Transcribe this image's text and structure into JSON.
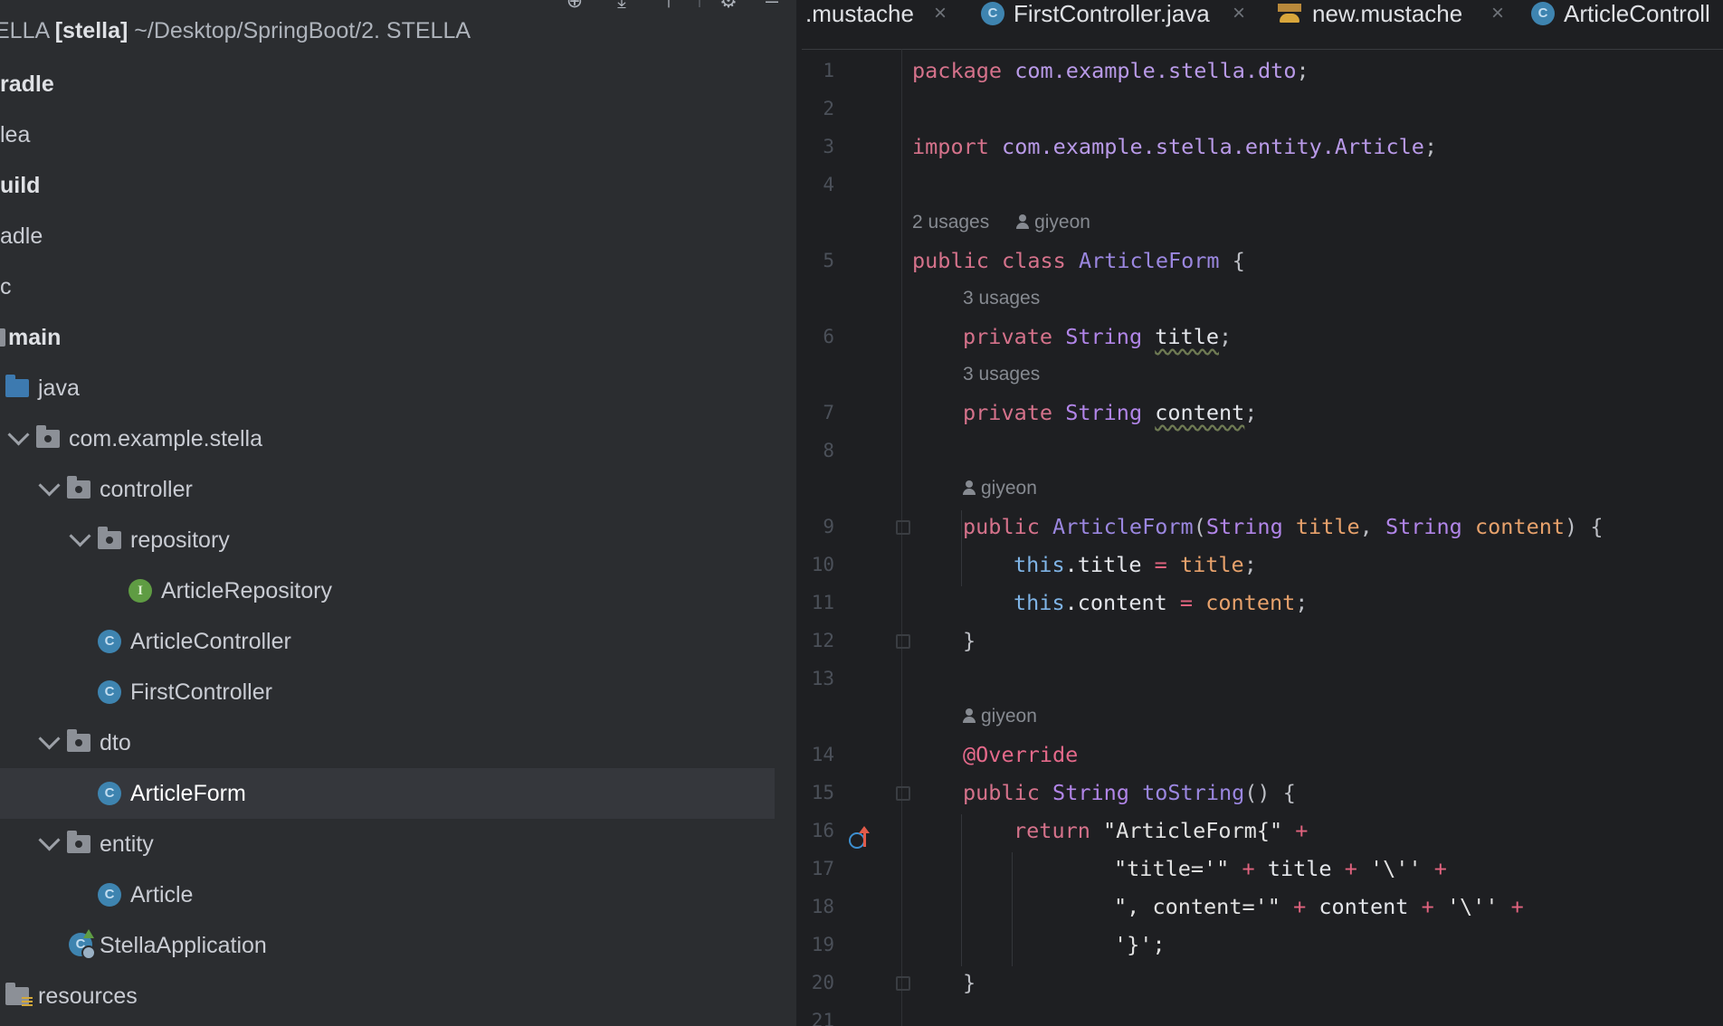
{
  "project": {
    "root_name": "ELLA",
    "root_bold": "[stella]",
    "root_path": "~/Desktop/SpringBoot/2. STELLA",
    "tree": [
      {
        "label": "radle",
        "bold": true
      },
      {
        "label": "lea"
      },
      {
        "label": "uild",
        "bold": true
      },
      {
        "label": "adle"
      },
      {
        "label": "c"
      },
      {
        "label": "main",
        "bold": true
      },
      {
        "label": "java"
      },
      {
        "label": "com.example.stella"
      },
      {
        "label": "controller"
      },
      {
        "label": "repository"
      },
      {
        "label": "ArticleRepository"
      },
      {
        "label": "ArticleController"
      },
      {
        "label": "FirstController"
      },
      {
        "label": "dto"
      },
      {
        "label": "ArticleForm"
      },
      {
        "label": "entity"
      },
      {
        "label": "Article"
      },
      {
        "label": "StellaApplication"
      },
      {
        "label": "resources"
      }
    ],
    "icons": {
      "class_letter": "C",
      "interface_letter": "I"
    }
  },
  "tabs": [
    {
      "label": ".mustache",
      "icon": "none"
    },
    {
      "label": "FirstController.java",
      "icon": "class-icon"
    },
    {
      "label": "new.mustache",
      "icon": "mustache-icon"
    },
    {
      "label": "ArticleControll",
      "icon": "class-icon"
    }
  ],
  "editor": {
    "line_numbers": [
      "1",
      "2",
      "3",
      "4",
      "5",
      "6",
      "7",
      "8",
      "9",
      "10",
      "11",
      "12",
      "13",
      "14",
      "15",
      "16",
      "17",
      "18",
      "19",
      "20",
      "21"
    ],
    "hints": {
      "usages_class": "2 usages",
      "author": "giyeon",
      "usages_field": "3 usages"
    },
    "code": {
      "l1_kw": "package",
      "l1_pkg": "com.example.stella.dto",
      "l1_end": ";",
      "l3_kw": "import",
      "l3_pkg": "com.example.stella.entity.Article",
      "l3_end": ";",
      "l5_kw": "public class",
      "l5_name": "ArticleForm",
      "l5_end": " {",
      "l6_kw": "private",
      "l6_type": "String",
      "l6_name": "title",
      "l6_end": ";",
      "l7_kw": "private",
      "l7_type": "String",
      "l7_name": "content",
      "l7_end": ";",
      "l9_kw": "public",
      "l9_name": "ArticleForm",
      "l9_open": "(",
      "l9_t1": "String",
      "l9_p1": "title",
      "l9_comma": ", ",
      "l9_t2": "String",
      "l9_p2": "content",
      "l9_end": ") {",
      "l10_this": "this",
      "l10_field": ".title",
      "l10_eq": " = ",
      "l10_val": "title",
      "l10_end": ";",
      "l11_this": "this",
      "l11_field": ".content",
      "l11_eq": " = ",
      "l11_val": "content",
      "l11_end": ";",
      "l12": "}",
      "l14": "@Override",
      "l15_kw": "public",
      "l15_type": "String",
      "l15_name": "toString",
      "l15_end": "() {",
      "l16_kw": "return",
      "l16_str": "\"ArticleForm{\"",
      "l16_plus": " +",
      "l17_str": "\"title='\"",
      "l17_p1": " + ",
      "l17_var": "title",
      "l17_p2": " + ",
      "l17_ch": "'\\''",
      "l17_p3": " +",
      "l18_str": "\", content='\"",
      "l18_p1": " + ",
      "l18_var": "content",
      "l18_p2": " + ",
      "l18_ch": "'\\''",
      "l18_p3": " +",
      "l19": "'}';",
      "l20": "}"
    }
  },
  "colors": {
    "keyword": "#cf8e6d",
    "type": "#b185e8",
    "background": "#1e1f22",
    "panel": "#2b2d30",
    "class_icon": "#3e84b0",
    "interface_icon": "#5f9c43"
  }
}
